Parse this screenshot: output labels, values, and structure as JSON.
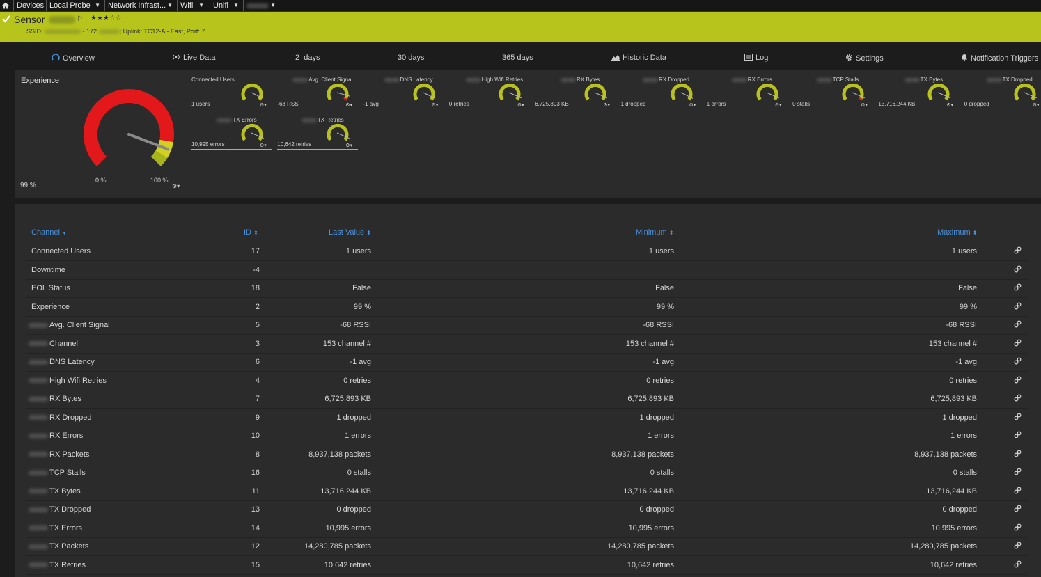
{
  "breadcrumb": {
    "items": [
      "Devices",
      "Local Probe",
      "Network Infrast...",
      "Wifi",
      "Unifi"
    ]
  },
  "header": {
    "title": "Sensor",
    "flag": "⚐",
    "stars": "★★★☆☆",
    "ssid_label": "SSID:",
    "ip_fragment": "- 172.",
    "uplink": "; Uplink: TC12-A - East, Port: 7"
  },
  "tabs": {
    "overview": "Overview",
    "live": "Live Data",
    "days2": "2  days",
    "days30": "30 days",
    "days365": "365 days",
    "historic": "Historic Data",
    "log": "Log",
    "settings": "Settings",
    "notifications": "Notification Triggers"
  },
  "experience_gauge": {
    "title": "Experience",
    "value_text": "99 %",
    "min_label": "0 %",
    "max_label": "100 %",
    "value_percent": 99
  },
  "mini_gauges": [
    {
      "title": "Connected Users",
      "value": "1 users",
      "blurred": false
    },
    {
      "title": "Avg. Client Signal",
      "value": "-68 RSSI",
      "blurred": true
    },
    {
      "title": "DNS Latency",
      "value": "-1 avg",
      "blurred": true
    },
    {
      "title": "High Wifi Retries",
      "value": "0 retries",
      "blurred": true
    },
    {
      "title": "RX Bytes",
      "value": "6,725,893 KB",
      "blurred": true
    },
    {
      "title": "RX Dropped",
      "value": "1 dropped",
      "blurred": true
    },
    {
      "title": "RX Errors",
      "value": "1 errors",
      "blurred": true
    },
    {
      "title": "TCP Stalls",
      "value": "0 stalls",
      "blurred": true
    },
    {
      "title": "TX Bytes",
      "value": "13,716,244 KB",
      "blurred": true
    },
    {
      "title": "TX Dropped",
      "value": "0 dropped",
      "blurred": true
    },
    {
      "title": "TX Errors",
      "value": "10,995 errors",
      "blurred": true
    },
    {
      "title": "TX Retries",
      "value": "10,642 retries",
      "blurred": true
    }
  ],
  "table": {
    "headers": {
      "channel": "Channel",
      "id": "ID",
      "last": "Last Value",
      "min": "Minimum",
      "max": "Maximum"
    },
    "rows": [
      {
        "name": "Connected Users",
        "blurred": false,
        "id": "17",
        "last": "1 users",
        "min": "1 users",
        "max": "1 users"
      },
      {
        "name": "Downtime",
        "blurred": false,
        "id": "-4",
        "last": "",
        "min": "",
        "max": ""
      },
      {
        "name": "EOL Status",
        "blurred": false,
        "id": "18",
        "last": "False",
        "min": "False",
        "max": "False"
      },
      {
        "name": "Experience",
        "blurred": false,
        "id": "2",
        "last": "99 %",
        "min": "99 %",
        "max": "99 %"
      },
      {
        "name": "Avg. Client Signal",
        "blurred": true,
        "id": "5",
        "last": "-68 RSSI",
        "min": "-68 RSSI",
        "max": "-68 RSSI"
      },
      {
        "name": "Channel",
        "blurred": true,
        "id": "3",
        "last": "153 channel #",
        "min": "153 channel #",
        "max": "153 channel #"
      },
      {
        "name": "DNS Latency",
        "blurred": true,
        "id": "6",
        "last": "-1 avg",
        "min": "-1 avg",
        "max": "-1 avg"
      },
      {
        "name": "High Wifi Retries",
        "blurred": true,
        "id": "4",
        "last": "0 retries",
        "min": "0 retries",
        "max": "0 retries"
      },
      {
        "name": "RX Bytes",
        "blurred": true,
        "id": "7",
        "last": "6,725,893 KB",
        "min": "6,725,893 KB",
        "max": "6,725,893 KB"
      },
      {
        "name": "RX Dropped",
        "blurred": true,
        "id": "9",
        "last": "1 dropped",
        "min": "1 dropped",
        "max": "1 dropped"
      },
      {
        "name": "RX Errors",
        "blurred": true,
        "id": "10",
        "last": "1 errors",
        "min": "1 errors",
        "max": "1 errors"
      },
      {
        "name": "RX Packets",
        "blurred": true,
        "id": "8",
        "last": "8,937,138 packets",
        "min": "8,937,138 packets",
        "max": "8,937,138 packets"
      },
      {
        "name": "TCP Stalls",
        "blurred": true,
        "id": "16",
        "last": "0 stalls",
        "min": "0 stalls",
        "max": "0 stalls"
      },
      {
        "name": "TX Bytes",
        "blurred": true,
        "id": "11",
        "last": "13,716,244 KB",
        "min": "13,716,244 KB",
        "max": "13,716,244 KB"
      },
      {
        "name": "TX Dropped",
        "blurred": true,
        "id": "13",
        "last": "0 dropped",
        "min": "0 dropped",
        "max": "0 dropped"
      },
      {
        "name": "TX Errors",
        "blurred": true,
        "id": "14",
        "last": "10,995 errors",
        "min": "10,995 errors",
        "max": "10,995 errors"
      },
      {
        "name": "TX Packets",
        "blurred": true,
        "id": "12",
        "last": "14,280,785 packets",
        "min": "14,280,785 packets",
        "max": "14,280,785 packets"
      },
      {
        "name": "TX Retries",
        "blurred": true,
        "id": "15",
        "last": "10,642 retries",
        "min": "10,642 retries",
        "max": "10,642 retries"
      }
    ]
  },
  "colors": {
    "accent": "#b7c41b",
    "gauge_red": "#e2181b",
    "gauge_yellow": "#d2d021",
    "gauge_green": "#a6b51c",
    "link": "#4a90d9"
  }
}
